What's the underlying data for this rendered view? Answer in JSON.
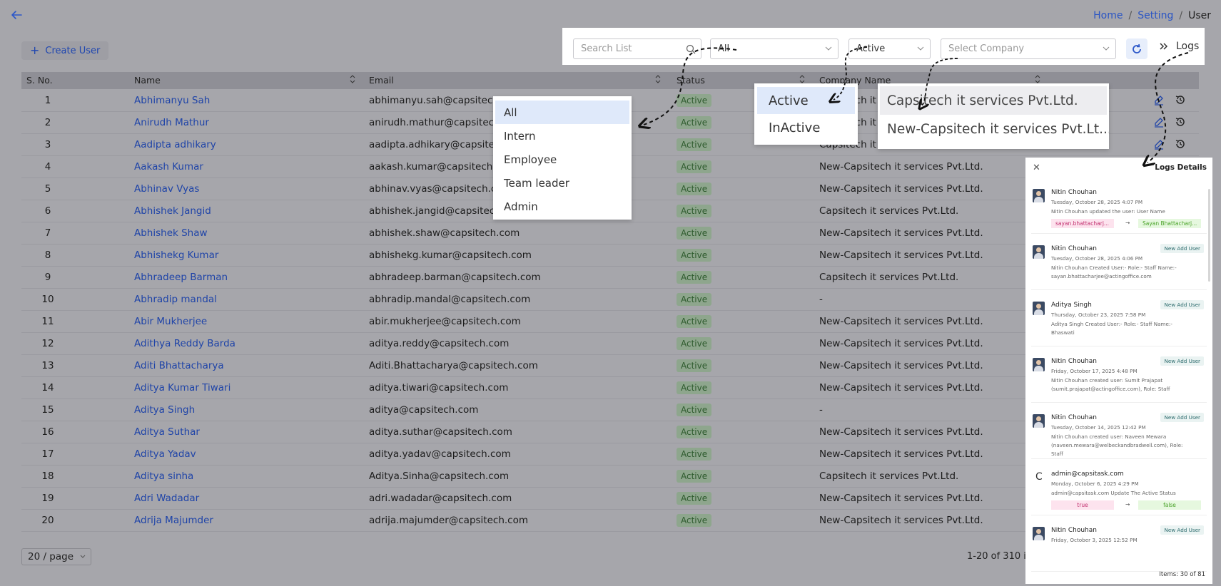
{
  "breadcrumb": {
    "home": "Home",
    "setting": "Setting",
    "current": "User",
    "sep": "/"
  },
  "create_button": {
    "label": "Create User"
  },
  "toolbar": {
    "search_placeholder": "Search List",
    "role_value": "All",
    "status_value": "Active",
    "company_placeholder": "Select Company",
    "logs_label": "Logs"
  },
  "table": {
    "headers": {
      "sno": "S. No.",
      "name": "Name",
      "email": "Email",
      "status": "Status",
      "company": "Company Name"
    },
    "rows": [
      {
        "no": "1",
        "name": "Abhimanyu Sah",
        "email": "abhimanyu.sah@capsitech.com",
        "status": "Active",
        "company": "Capsitech it services Pvt.Ltd."
      },
      {
        "no": "2",
        "name": "Anirudh Mathur",
        "email": "anirudh.mathur@capsitech.com",
        "status": "Active",
        "company": "Capsitech it services Pvt.Ltd."
      },
      {
        "no": "3",
        "name": "Aadipta adhikary",
        "email": "aadipta.adhikary@capsitech.com",
        "status": "Active",
        "company": "Capsitech it services Pvt.Ltd."
      },
      {
        "no": "4",
        "name": "Aakash Kumar",
        "email": "aakash.kumar@capsitech.com",
        "status": "Active",
        "company": "New-Capsitech it services Pvt.Ltd."
      },
      {
        "no": "5",
        "name": "Abhinav Vyas",
        "email": "abhinav.vyas@capsitech.com",
        "status": "Active",
        "company": "New-Capsitech it services Pvt.Ltd."
      },
      {
        "no": "6",
        "name": "Abhishek Jangid",
        "email": "abhishek.jangid@capsitech.com",
        "status": "Active",
        "company": "Capsitech it services Pvt.Ltd."
      },
      {
        "no": "7",
        "name": "Abhishek Shaw",
        "email": "abhishek.shaw@capsitech.com",
        "status": "Active",
        "company": "New-Capsitech it services Pvt.Ltd."
      },
      {
        "no": "8",
        "name": "Abhishekg Kumar",
        "email": "abhishekg.kumar@capsitech.com",
        "status": "Active",
        "company": "New-Capsitech it services Pvt.Ltd."
      },
      {
        "no": "9",
        "name": "Abhradeep Barman",
        "email": "abhradeep.barman@capsitech.com",
        "status": "Active",
        "company": "Capsitech it services Pvt.Ltd."
      },
      {
        "no": "10",
        "name": "Abhradip mandal",
        "email": "abhradip.mandal@capsitech.com",
        "status": "Active",
        "company": "-"
      },
      {
        "no": "11",
        "name": "Abir Mukherjee",
        "email": "abir.mukherjee@capsitech.com",
        "status": "Active",
        "company": "New-Capsitech it services Pvt.Ltd."
      },
      {
        "no": "12",
        "name": "Adithya Reddy Barda",
        "email": "aditya.reddy@capsitech.com",
        "status": "Active",
        "company": "New-Capsitech it services Pvt.Ltd."
      },
      {
        "no": "13",
        "name": "Aditi Bhattacharya",
        "email": "Aditi.Bhattacharya@capsitech.com",
        "status": "Active",
        "company": "New-Capsitech it services Pvt.Ltd."
      },
      {
        "no": "14",
        "name": "Aditya Kumar Tiwari",
        "email": "aditya.tiwari@capsitech.com",
        "status": "Active",
        "company": "New-Capsitech it services Pvt.Ltd."
      },
      {
        "no": "15",
        "name": "Aditya Singh",
        "email": "aditya@capsitech.com",
        "status": "Active",
        "company": "-"
      },
      {
        "no": "16",
        "name": "Aditya Suthar",
        "email": "aditya.suthar@capsitech.com",
        "status": "Active",
        "company": "New-Capsitech it services Pvt.Ltd."
      },
      {
        "no": "17",
        "name": "Aditya Yadav",
        "email": "aditya.yadav@capsitech.com",
        "status": "Active",
        "company": "New-Capsitech it services Pvt.Ltd."
      },
      {
        "no": "18",
        "name": "Aditya sinha",
        "email": "Aditya.Sinha@capsitech.com",
        "status": "Active",
        "company": "Capsitech it services Pvt.Ltd."
      },
      {
        "no": "19",
        "name": "Adri Wadadar",
        "email": "adri.wadadar@capsitech.com",
        "status": "Active",
        "company": "New-Capsitech it services Pvt.Ltd."
      },
      {
        "no": "20",
        "name": "Adrija Majumder",
        "email": "adrija.majumder@capsitech.com",
        "status": "Active",
        "company": "New-Capsitech it services Pvt.Ltd."
      }
    ]
  },
  "pagination": {
    "page_size": "20 / page",
    "range": "1-20 of 310 ite"
  },
  "role_dropdown": {
    "options": [
      "All",
      "Intern",
      "Employee",
      "Team leader",
      "Admin"
    ]
  },
  "status_dropdown": {
    "options": [
      "Active",
      "InActive"
    ]
  },
  "company_dropdown": {
    "options": [
      "Capsitech it services Pvt.Ltd.",
      "New-Capsitech it services Pvt.Lt..."
    ]
  },
  "logs": {
    "title": "Logs Details",
    "footer": "Items: 30 of 81",
    "entries": [
      {
        "name": "Nitin Chouhan",
        "date": "Tuesday, October 28, 2025 4:07 PM",
        "desc": "Nitin Chouhan updated the user: User Name",
        "badge": "",
        "old": "sayan.bhattacharj...",
        "new": "Sayan Bhattacharj..."
      },
      {
        "name": "Nitin Chouhan",
        "date": "Tuesday, October 28, 2025 4:06 PM",
        "desc": "Nitin Chouhan Created User:- Role:- Staff Name:- sayan.bhattacharjee@actingoffice.com",
        "badge": "New Add User"
      },
      {
        "name": "Aditya Singh",
        "date": "Thursday, October 23, 2025 7:58 PM",
        "desc": "Aditya Singh Created User:- Role:- Staff Name:- Bhaswati",
        "badge": "New Add User"
      },
      {
        "name": "Nitin Chouhan",
        "date": "Friday, October 17, 2025 4:48 PM",
        "desc": "Nitin Chouhan created user: Sumit Prajapat (sumit.prajapat@actingoffice.com), Role: Staff",
        "badge": "New Add User"
      },
      {
        "name": "Nitin Chouhan",
        "date": "Tuesday, October 14, 2025 12:42 PM",
        "desc": "Nitin Chouhan created user: Naveen Mewara (naveen.mewara@welbeckandbradwell.com), Role: Staff",
        "badge": "New Add User"
      },
      {
        "name": "admin@capsitask.com",
        "date": "Monday, October 6, 2025 4:29 PM",
        "desc": "admin@capsitask.com Update The Active Status",
        "badge": "",
        "old": "true",
        "new": "false"
      },
      {
        "name": "Nitin Chouhan",
        "date": "Friday, October 3, 2025 12:52 PM",
        "desc": "",
        "badge": "New Add User"
      }
    ]
  },
  "colors": {
    "link": "#1f44a8",
    "active_badge": "#8ea68d",
    "accent": "#2b57c9"
  }
}
